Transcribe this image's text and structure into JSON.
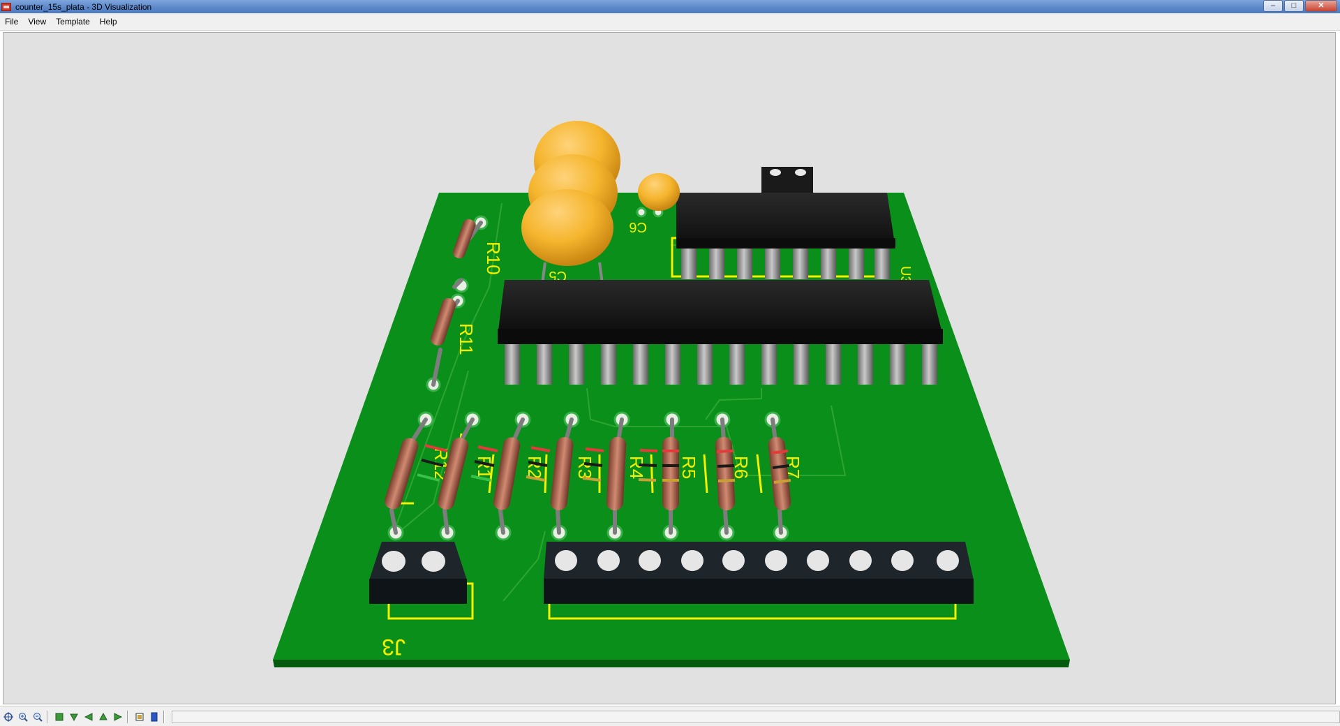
{
  "window": {
    "title": "counter_15s_plata - 3D Visualization",
    "controls": {
      "minimize": "–",
      "maximize": "□",
      "close": "✕"
    }
  },
  "menu": [
    "File",
    "View",
    "Template",
    "Help"
  ],
  "board": {
    "pcb_color": "#0a8f1b",
    "silkscreen_color": "#f5f000",
    "capacitor_color": "#f5b52d",
    "labels": {
      "r10": "R10",
      "r11": "R11",
      "r12": "R12",
      "r1": "R1",
      "r2": "R2",
      "r3": "R3",
      "r4": "R4",
      "r5": "R5",
      "r6": "R6",
      "r7": "R7",
      "c5": "C5",
      "c6": "C6",
      "u3": "U3",
      "j3": "J3"
    }
  },
  "toolbar": {
    "icons": [
      "pan-icon",
      "zoom-in-icon",
      "zoom-out-icon",
      "view-top-icon",
      "view-front-icon",
      "view-left-icon",
      "view-back-icon",
      "view-right-icon",
      "fit-icon",
      "exit-icon"
    ]
  },
  "status": {
    "text": ""
  }
}
